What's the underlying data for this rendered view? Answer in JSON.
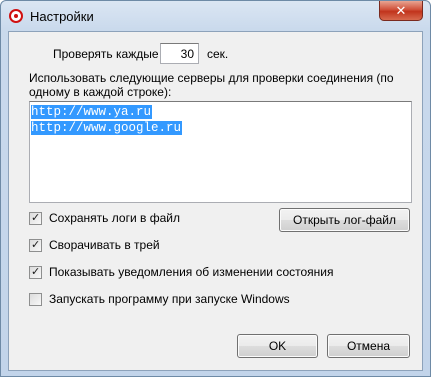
{
  "window": {
    "title": "Настройки",
    "close_label": "✕"
  },
  "interval": {
    "label_before": "Проверять каждые",
    "value": "30",
    "label_after": "сек."
  },
  "servers": {
    "label": "Использовать следующие серверы для проверки соединения (по одному в каждой строке):",
    "lines": [
      "http://www.ya.ru",
      "http://www.google.ru"
    ]
  },
  "options": [
    {
      "label": "Сохранять логи в файл",
      "checked": true
    },
    {
      "label": "Сворачивать в трей",
      "checked": true
    },
    {
      "label": "Показывать уведомления об изменении состояния",
      "checked": true
    },
    {
      "label": "Запускать программу при запуске Windows",
      "checked": false
    }
  ],
  "buttons": {
    "open_log": "Открыть лог-файл",
    "ok": "OK",
    "cancel": "Отмена"
  }
}
